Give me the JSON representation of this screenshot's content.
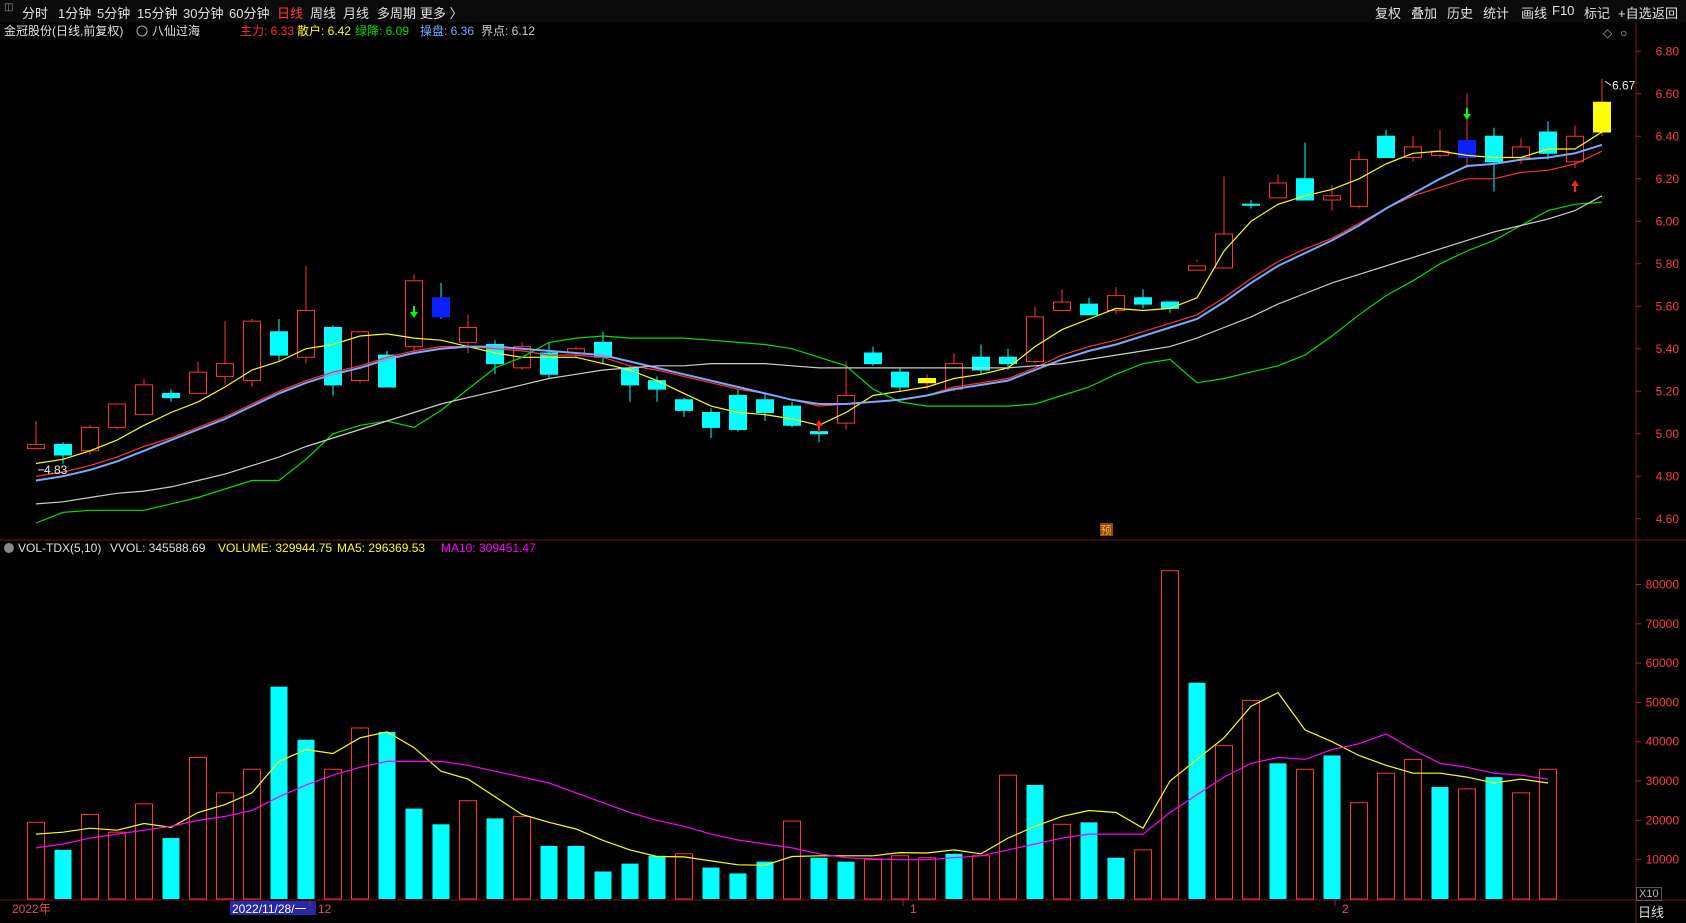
{
  "toolbar": {
    "left": [
      {
        "key": "fs",
        "label": "分时"
      },
      {
        "key": "m1",
        "label": "1分钟"
      },
      {
        "key": "m5",
        "label": "5分钟"
      },
      {
        "key": "m15",
        "label": "15分钟"
      },
      {
        "key": "m30",
        "label": "30分钟"
      },
      {
        "key": "m60",
        "label": "60分钟"
      },
      {
        "key": "day",
        "label": "日线",
        "active": true
      },
      {
        "key": "week",
        "label": "周线"
      },
      {
        "key": "month",
        "label": "月线"
      },
      {
        "key": "multi",
        "label": "多周期"
      },
      {
        "key": "more",
        "label": "更多 〉"
      }
    ],
    "right": [
      {
        "key": "fq",
        "label": "复权"
      },
      {
        "key": "dj",
        "label": "叠加"
      },
      {
        "key": "ls",
        "label": "历史"
      },
      {
        "key": "tj",
        "label": "统计"
      },
      {
        "key": "hx",
        "label": "画线"
      },
      {
        "key": "f10",
        "label": "F10"
      },
      {
        "key": "bj",
        "label": "标记"
      },
      {
        "key": "zx",
        "label": "+自选"
      },
      {
        "key": "fh",
        "label": "返回"
      }
    ]
  },
  "price_header": {
    "stock": "金冠股份(日线,前复权)",
    "indicator": "八仙过海",
    "items": [
      {
        "label": "主力:",
        "value": "6.33",
        "color": "#ff3030"
      },
      {
        "label": "散户:",
        "value": "6.42",
        "color": "#ffff00"
      },
      {
        "label": "绿降:",
        "value": "6.09",
        "color": "#00e000"
      },
      {
        "label": "操盘:",
        "value": "6.36",
        "color": "#7aa8ff"
      },
      {
        "label": "界点:",
        "value": "6.12",
        "color": "#cccccc"
      }
    ]
  },
  "volume_header": {
    "name": "VOL-TDX(5,10)",
    "vvol": "VVOL: 345588.69",
    "volume": "VOLUME: 329944.75",
    "ma5": "MA5: 296369.53",
    "ma10": "MA10: 309451.47"
  },
  "colors": {
    "up": "#ff3232",
    "down": "#00ffff",
    "ma_main": "#ff3030",
    "ma_retail": "#ffff00",
    "ma_green": "#00e000",
    "ma_op": "#7aa8ff",
    "ma_joint": "#cccccc",
    "vol_ma10": "#ff00ff"
  },
  "chart_data": [
    {
      "type": "candlestick",
      "ylim": [
        4.5,
        6.9
      ],
      "yticks": [
        "6.80",
        "6.60",
        "6.40",
        "6.20",
        "6.00",
        "5.80",
        "5.60",
        "5.40",
        "5.20",
        "5.00",
        "4.80",
        "4.60"
      ],
      "x_labels": [
        "2022年",
        "2022/11/28/一",
        "12",
        "1",
        "2"
      ],
      "annotations": [
        {
          "text": "6.67"
        },
        {
          "text": "4.83"
        },
        {
          "text": "预"
        }
      ],
      "candles": [
        [
          4.93,
          4.95,
          5.06,
          4.93
        ],
        [
          4.9,
          4.95,
          4.96,
          4.86
        ],
        [
          4.92,
          5.03,
          5.04,
          4.9
        ],
        [
          5.03,
          5.14,
          5.14,
          5.02
        ],
        [
          5.09,
          5.23,
          5.26,
          5.09
        ],
        [
          5.19,
          5.17,
          5.21,
          5.15
        ],
        [
          5.19,
          5.29,
          5.34,
          5.19
        ],
        [
          5.27,
          5.33,
          5.53,
          5.23
        ],
        [
          5.25,
          5.53,
          5.54,
          5.22
        ],
        [
          5.48,
          5.37,
          5.54,
          5.34
        ],
        [
          5.36,
          5.58,
          5.79,
          5.33
        ],
        [
          5.5,
          5.23,
          5.51,
          5.18
        ],
        [
          5.25,
          5.48,
          5.47,
          5.24
        ],
        [
          5.22,
          5.37,
          5.39,
          5.23
        ],
        [
          5.72,
          5.41,
          5.75,
          5.38
        ],
        [
          5.64,
          5.55,
          5.71,
          5.54
        ],
        [
          5.5,
          5.43,
          5.56,
          5.38
        ],
        [
          5.42,
          5.33,
          5.44,
          5.28
        ],
        [
          5.41,
          5.31,
          5.43,
          5.3
        ],
        [
          5.38,
          5.28,
          5.43,
          5.26
        ],
        [
          5.38,
          5.4,
          5.41,
          5.36
        ],
        [
          5.43,
          5.36,
          5.48,
          5.33
        ],
        [
          5.31,
          5.23,
          5.32,
          5.15
        ],
        [
          5.25,
          5.21,
          5.27,
          5.15
        ],
        [
          5.16,
          5.11,
          5.17,
          5.08
        ],
        [
          5.1,
          5.03,
          5.12,
          4.98
        ],
        [
          5.18,
          5.02,
          5.21,
          5.01
        ],
        [
          5.16,
          5.1,
          5.19,
          5.06
        ],
        [
          5.13,
          5.04,
          5.15,
          5.03
        ],
        [
          5.01,
          5.0,
          5.03,
          4.96
        ],
        [
          5.05,
          5.18,
          5.34,
          5.02
        ],
        [
          5.38,
          5.33,
          5.41,
          5.32
        ],
        [
          5.29,
          5.22,
          5.31,
          5.2
        ],
        [
          5.24,
          5.26,
          5.28,
          5.21
        ],
        [
          5.21,
          5.33,
          5.38,
          5.2
        ],
        [
          5.3,
          5.36,
          5.42,
          5.28
        ],
        [
          5.33,
          5.36,
          5.4,
          5.3
        ],
        [
          5.34,
          5.55,
          5.6,
          5.33
        ],
        [
          5.58,
          5.62,
          5.68,
          5.59
        ],
        [
          5.61,
          5.56,
          5.64,
          5.56
        ],
        [
          5.58,
          5.65,
          5.69,
          5.56
        ],
        [
          5.64,
          5.61,
          5.68,
          5.59
        ],
        [
          5.62,
          5.59,
          5.62,
          5.57
        ],
        [
          5.77,
          5.79,
          5.81,
          5.82
        ],
        [
          5.78,
          5.94,
          6.21,
          5.94
        ],
        [
          6.08,
          6.08,
          6.1,
          6.06
        ],
        [
          6.11,
          6.18,
          6.22,
          6.11
        ],
        [
          6.2,
          6.1,
          6.37,
          6.2
        ],
        [
          6.1,
          6.12,
          6.17,
          6.05
        ],
        [
          6.07,
          6.29,
          6.33,
          6.06
        ],
        [
          6.3,
          6.4,
          6.43,
          6.3
        ],
        [
          6.35,
          6.3,
          6.4,
          6.28
        ],
        [
          6.31,
          6.33,
          6.43,
          6.3
        ],
        [
          6.3,
          6.38,
          6.6,
          6.25
        ],
        [
          6.4,
          6.28,
          6.44,
          6.14
        ],
        [
          6.3,
          6.35,
          6.39,
          6.27
        ],
        [
          6.42,
          6.32,
          6.47,
          6.29
        ],
        [
          6.28,
          6.4,
          6.45,
          6.25
        ],
        [
          6.42,
          6.56,
          6.67,
          6.4
        ]
      ],
      "candle_colors": [
        "up",
        "down",
        "up",
        "up",
        "up",
        "down",
        "up",
        "up",
        "up",
        "down",
        "up",
        "down",
        "up",
        "down",
        "up",
        "down",
        "up",
        "down",
        "up",
        "down",
        "up",
        "down",
        "down",
        "down",
        "down",
        "down",
        "down",
        "down",
        "down",
        "down",
        "up",
        "down",
        "down",
        "up",
        "up",
        "down",
        "down",
        "up",
        "up",
        "down",
        "up",
        "down",
        "down",
        "up",
        "up",
        "down",
        "up",
        "down",
        "up",
        "up",
        "down",
        "up",
        "up",
        "up",
        "down",
        "up",
        "down",
        "up",
        "up"
      ],
      "special_candles": [
        {
          "index": 15,
          "color": "#0a20ff"
        },
        {
          "index": 33,
          "color": "#ffff00"
        },
        {
          "index": 53,
          "color": "#0a20ff"
        },
        {
          "index": 58,
          "color": "#ffff00"
        }
      ],
      "series": [
        {
          "name": "主力",
          "color": "#ff3030",
          "values": [
            4.8,
            4.82,
            4.85,
            4.89,
            4.94,
            4.98,
            5.03,
            5.08,
            5.14,
            5.2,
            5.25,
            5.29,
            5.32,
            5.36,
            5.39,
            5.41,
            5.41,
            5.4,
            5.39,
            5.37,
            5.37,
            5.36,
            5.32,
            5.3,
            5.27,
            5.24,
            5.21,
            5.19,
            5.16,
            5.13,
            5.14,
            5.15,
            5.16,
            5.18,
            5.22,
            5.24,
            5.26,
            5.31,
            5.37,
            5.41,
            5.44,
            5.48,
            5.52,
            5.56,
            5.64,
            5.73,
            5.81,
            5.87,
            5.92,
            5.99,
            6.06,
            6.12,
            6.16,
            6.2,
            6.2,
            6.23,
            6.24,
            6.27,
            6.33
          ]
        },
        {
          "name": "散户",
          "color": "#ffff00",
          "values": [
            4.86,
            4.88,
            4.92,
            4.97,
            5.04,
            5.1,
            5.15,
            5.22,
            5.3,
            5.34,
            5.4,
            5.42,
            5.46,
            5.47,
            5.45,
            5.44,
            5.41,
            5.38,
            5.36,
            5.36,
            5.36,
            5.33,
            5.3,
            5.25,
            5.19,
            5.13,
            5.1,
            5.09,
            5.07,
            5.04,
            5.1,
            5.18,
            5.2,
            5.22,
            5.26,
            5.28,
            5.31,
            5.41,
            5.49,
            5.54,
            5.59,
            5.58,
            5.59,
            5.64,
            5.86,
            6.0,
            6.08,
            6.12,
            6.15,
            6.2,
            6.27,
            6.32,
            6.33,
            6.31,
            6.3,
            6.3,
            6.34,
            6.34,
            6.42
          ]
        },
        {
          "name": "绿降",
          "color": "#00e000",
          "values": [
            4.58,
            4.63,
            4.64,
            4.64,
            4.64,
            4.67,
            4.7,
            4.74,
            4.78,
            4.78,
            4.88,
            5.0,
            5.04,
            5.06,
            5.03,
            5.11,
            5.21,
            5.31,
            5.36,
            5.43,
            5.45,
            5.46,
            5.45,
            5.45,
            5.45,
            5.44,
            5.43,
            5.42,
            5.4,
            5.36,
            5.32,
            5.21,
            5.15,
            5.13,
            5.13,
            5.13,
            5.13,
            5.14,
            5.18,
            5.22,
            5.28,
            5.33,
            5.35,
            5.24,
            5.26,
            5.29,
            5.32,
            5.37,
            5.46,
            5.56,
            5.65,
            5.72,
            5.8,
            5.86,
            5.91,
            5.98,
            6.05,
            6.08,
            6.09
          ]
        },
        {
          "name": "操盘",
          "color": "#7aa8ff",
          "values": [
            4.78,
            4.8,
            4.83,
            4.87,
            4.92,
            4.97,
            5.02,
            5.07,
            5.13,
            5.19,
            5.24,
            5.28,
            5.31,
            5.35,
            5.38,
            5.4,
            5.41,
            5.41,
            5.4,
            5.39,
            5.38,
            5.37,
            5.34,
            5.31,
            5.28,
            5.25,
            5.22,
            5.19,
            5.16,
            5.14,
            5.14,
            5.15,
            5.16,
            5.18,
            5.21,
            5.23,
            5.25,
            5.3,
            5.35,
            5.39,
            5.42,
            5.46,
            5.5,
            5.54,
            5.62,
            5.71,
            5.79,
            5.85,
            5.91,
            5.98,
            6.06,
            6.13,
            6.2,
            6.26,
            6.27,
            6.29,
            6.3,
            6.32,
            6.36
          ]
        },
        {
          "name": "界点",
          "color": "#cccccc",
          "values": [
            4.67,
            4.68,
            4.7,
            4.72,
            4.73,
            4.75,
            4.78,
            4.81,
            4.85,
            4.89,
            4.94,
            4.98,
            5.02,
            5.06,
            5.1,
            5.14,
            5.17,
            5.2,
            5.23,
            5.26,
            5.28,
            5.3,
            5.31,
            5.32,
            5.32,
            5.33,
            5.33,
            5.33,
            5.32,
            5.31,
            5.31,
            5.31,
            5.31,
            5.31,
            5.31,
            5.31,
            5.31,
            5.32,
            5.33,
            5.35,
            5.37,
            5.39,
            5.41,
            5.45,
            5.5,
            5.55,
            5.61,
            5.66,
            5.71,
            5.75,
            5.79,
            5.83,
            5.87,
            5.91,
            5.95,
            5.98,
            6.01,
            6.05,
            6.12
          ]
        }
      ]
    },
    {
      "type": "bar",
      "ylim": [
        0,
        88000
      ],
      "yticks": [
        "80000",
        "70000",
        "60000",
        "50000",
        "40000",
        "30000",
        "20000",
        "10000"
      ],
      "scale_label": "X10",
      "values": [
        19500,
        12500,
        21500,
        17000,
        24200,
        15500,
        36000,
        27000,
        33000,
        54000,
        40500,
        33000,
        43500,
        42500,
        23000,
        19000,
        25000,
        20500,
        21000,
        13500,
        13500,
        7000,
        9000,
        11000,
        11500,
        8000,
        6500,
        9500,
        19800,
        10500,
        9500,
        10000,
        11000,
        10500,
        11500,
        11000,
        31500,
        29000,
        19000,
        19500,
        10500,
        12500,
        83500,
        55000,
        39000,
        50500,
        34500,
        33000,
        36500,
        24500,
        32000,
        35500,
        28500,
        28000,
        31000,
        27000,
        33000
      ],
      "bar_colors": [
        "up",
        "down",
        "up",
        "up",
        "up",
        "down",
        "up",
        "up",
        "up",
        "down",
        "down",
        "up",
        "up",
        "down",
        "down",
        "down",
        "up",
        "down",
        "up",
        "down",
        "down",
        "down",
        "down",
        "down",
        "up",
        "down",
        "down",
        "down",
        "up",
        "down",
        "down",
        "up",
        "up",
        "up",
        "down",
        "up",
        "up",
        "down",
        "up",
        "down",
        "down",
        "up",
        "up",
        "down",
        "up",
        "up",
        "down",
        "up",
        "down",
        "up",
        "up",
        "up",
        "down",
        "up",
        "down",
        "up",
        "up"
      ],
      "series": [
        {
          "name": "MA5",
          "color": "#ffff00",
          "values": [
            16500,
            17000,
            18000,
            17500,
            19200,
            18200,
            22000,
            24000,
            27000,
            35000,
            38000,
            37000,
            41000,
            42500,
            38500,
            32500,
            30500,
            26000,
            21500,
            19500,
            17800,
            14900,
            12500,
            10800,
            10700,
            9700,
            8700,
            8600,
            10800,
            11000,
            11000,
            11000,
            11800,
            11700,
            12500,
            11500,
            15500,
            18500,
            21000,
            22500,
            22000,
            18000,
            30000,
            35500,
            41000,
            49000,
            52500,
            43000,
            40000,
            36500,
            34000,
            32000,
            32000,
            31000,
            29500,
            30500,
            29500
          ]
        },
        {
          "name": "MA10",
          "color": "#ff00ff",
          "values": [
            13000,
            14000,
            15500,
            16500,
            17500,
            18500,
            20000,
            21000,
            22500,
            26000,
            29000,
            31500,
            33500,
            35000,
            35000,
            35000,
            34000,
            32500,
            31000,
            29500,
            27000,
            24500,
            22000,
            20000,
            18500,
            16500,
            15000,
            14000,
            13000,
            11500,
            10500,
            10200,
            10000,
            10000,
            10500,
            11000,
            12500,
            14000,
            15500,
            16500,
            16500,
            16500,
            22000,
            26500,
            31000,
            34500,
            36000,
            35500,
            38000,
            39500,
            42000,
            38000,
            34500,
            33500,
            32000,
            31500,
            30500
          ]
        }
      ]
    }
  ],
  "bottom": {
    "period": "日线"
  }
}
